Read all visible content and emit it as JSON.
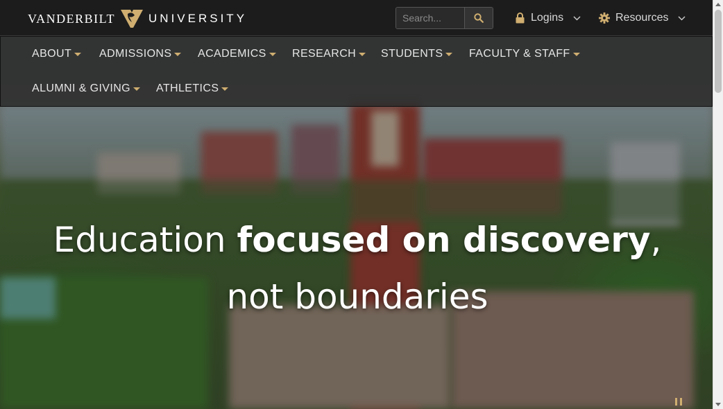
{
  "brand": {
    "word1": "VANDERBILT",
    "word2": "UNIVERSITY",
    "gold": "#cfae70"
  },
  "search": {
    "placeholder": "Search..."
  },
  "toplinks": [
    {
      "label": "Logins",
      "icon": "lock-icon"
    },
    {
      "label": "Resources",
      "icon": "gear-icon"
    }
  ],
  "nav": {
    "items": [
      {
        "label": "ABOUT"
      },
      {
        "label": "ADMISSIONS"
      },
      {
        "label": "ACADEMICS"
      },
      {
        "label": "RESEARCH"
      },
      {
        "label": "STUDENTS"
      },
      {
        "label": "FACULTY & STAFF"
      },
      {
        "label": "ALUMNI & GIVING"
      },
      {
        "label": "ATHLETICS"
      }
    ]
  },
  "hero": {
    "part1": "Education ",
    "part2": "focused on discovery",
    "part3": ", not boundaries"
  }
}
